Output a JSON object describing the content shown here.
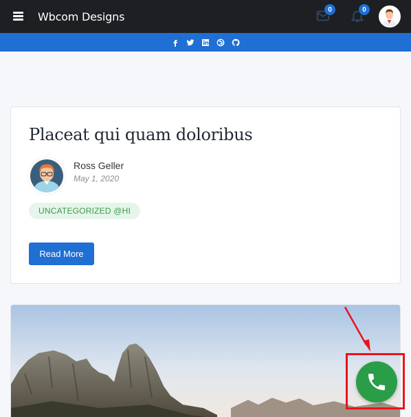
{
  "topbar": {
    "brand": "Wbcom Designs",
    "messages_count": "0",
    "notifications_count": "0",
    "icons": [
      "menu-icon",
      "envelope-icon",
      "bell-icon",
      "user-avatar"
    ]
  },
  "social": {
    "icons": [
      "facebook-icon",
      "twitter-icon",
      "linkedin-icon",
      "dribbble-icon",
      "github-icon"
    ]
  },
  "post": {
    "title": "Placeat qui quam doloribus",
    "author": "Ross Geller",
    "date": "May 1, 2020",
    "category": "UNCATEGORIZED @HI",
    "read_more": "Read More"
  },
  "colors": {
    "topbar": "#1d1f22",
    "accent": "#1f6fd4",
    "category_bg": "#e6f5e9",
    "category_text": "#3c9a4b",
    "phone_fab": "#2a9d48",
    "annotation": "#e8141c"
  },
  "floating": {
    "phone_icon": "phone-icon"
  }
}
